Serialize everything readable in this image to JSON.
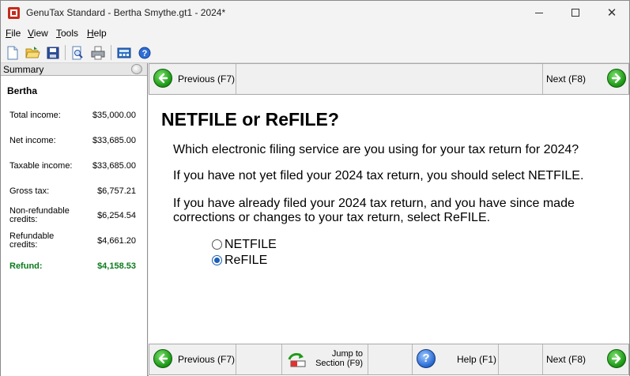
{
  "window": {
    "title": "GenuTax Standard - Bertha Smythe.gt1 - 2024*"
  },
  "menu": {
    "items": [
      {
        "first": "F",
        "rest": "ile"
      },
      {
        "first": "V",
        "rest": "iew"
      },
      {
        "first": "T",
        "rest": "ools"
      },
      {
        "first": "H",
        "rest": "elp"
      }
    ]
  },
  "toolbar": {
    "icons": [
      "new-file-icon",
      "open-folder-icon",
      "save-icon",
      "print-preview-icon",
      "print-icon",
      "calculator-icon",
      "help-icon"
    ]
  },
  "summary": {
    "header": "Summary",
    "name": "Bertha",
    "rows": [
      {
        "label": "Total income:",
        "value": "$35,000.00"
      },
      {
        "label": "Net income:",
        "value": "$33,685.00"
      },
      {
        "label": "Taxable income:",
        "value": "$33,685.00"
      },
      {
        "label": "Gross tax:",
        "value": "$6,757.21"
      },
      {
        "label_line1": "Non-refundable",
        "label_line2": "credits:",
        "value": "$6,254.54"
      },
      {
        "label_line1": "Refundable",
        "label_line2": "credits:",
        "value": "$4,661.20"
      },
      {
        "label": "Refund:",
        "value": "$4,158.53"
      }
    ],
    "refund_color": "#0b7a1c"
  },
  "nav": {
    "previous": "Previous (F7)",
    "next": "Next (F8)",
    "jump_line1": "Jump to",
    "jump_line2": "Section (F9)",
    "help": "Help (F1)"
  },
  "content": {
    "title": "NETFILE or ReFILE?",
    "question": "Which electronic filing service are you using for your tax return for 2024?",
    "para1": "If you have not yet filed your 2024 tax return, you should select NETFILE.",
    "para2_line1": "If you have already filed your 2024 tax return, and you have since made",
    "para2_line2": "corrections or changes to your tax return, select ReFILE.",
    "options": [
      {
        "label": "NETFILE",
        "selected": false
      },
      {
        "label": "ReFILE",
        "selected": true
      }
    ]
  },
  "colors": {
    "accent_green": "#1f9a18",
    "radio_blue": "#1c5fb8"
  }
}
